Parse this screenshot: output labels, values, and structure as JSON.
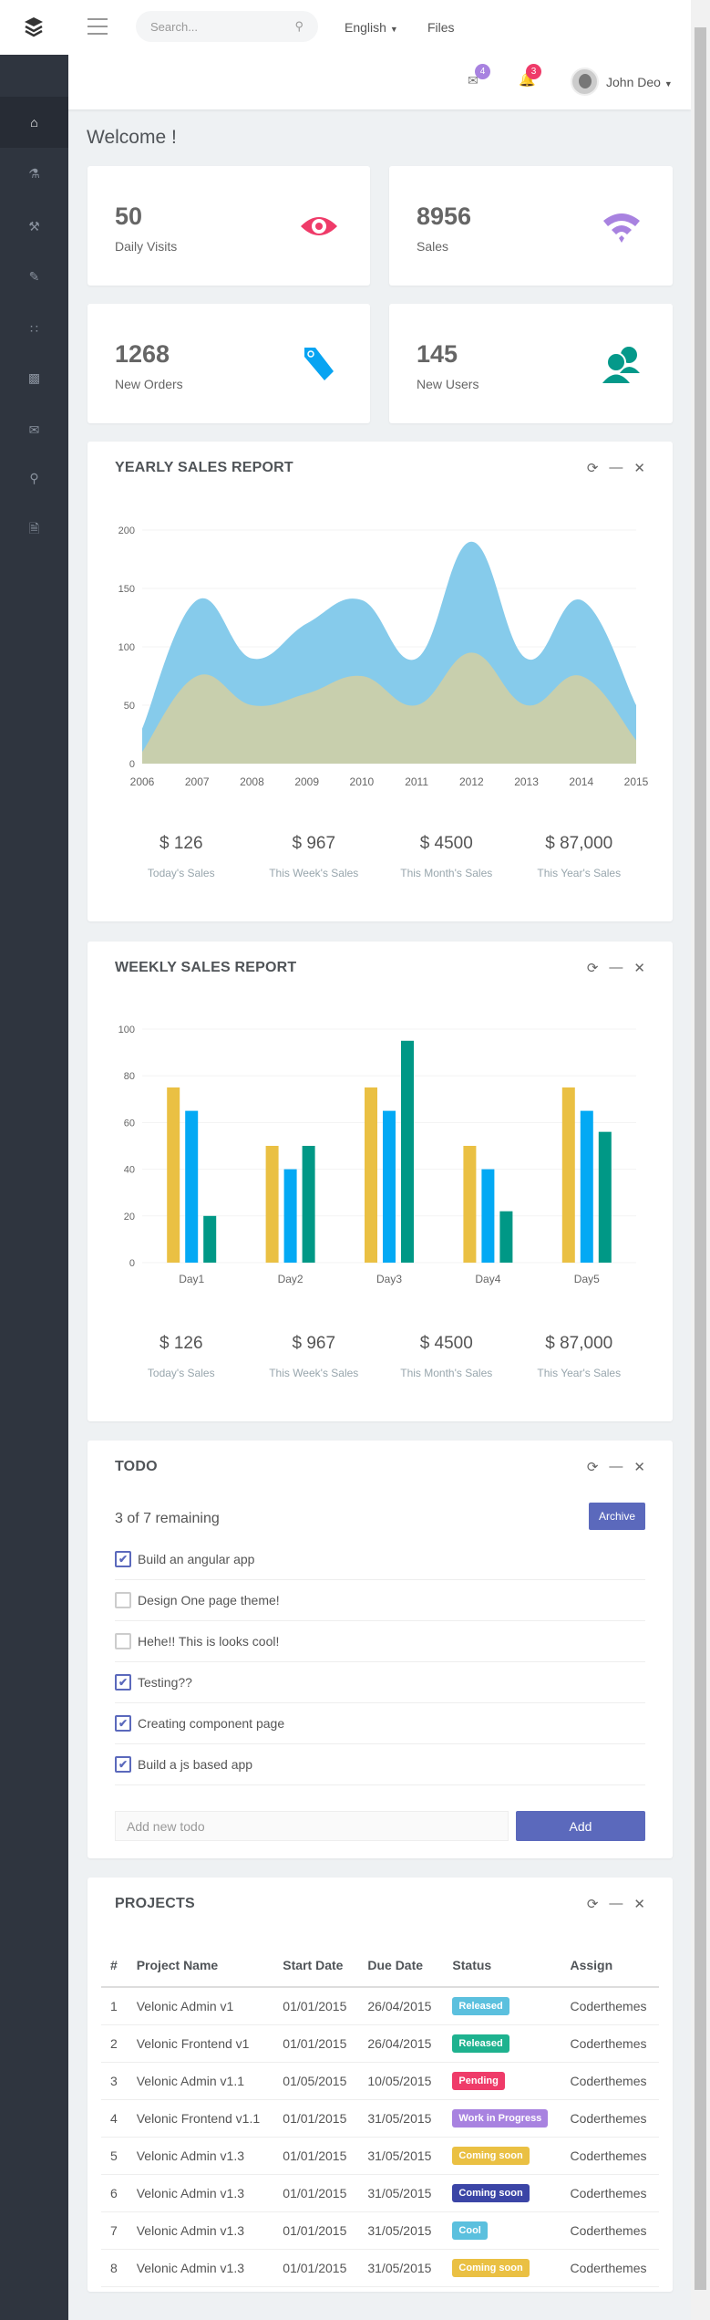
{
  "topbar": {
    "search_placeholder": "Search...",
    "language": "English",
    "files": "Files",
    "mail_count": "4",
    "notif_count": "3",
    "user_name": "John Deo"
  },
  "sidebar": {
    "items": [
      {
        "icon": "home-icon"
      },
      {
        "icon": "flask-icon"
      },
      {
        "icon": "tools-icon"
      },
      {
        "icon": "edit-icon"
      },
      {
        "icon": "grid-icon"
      },
      {
        "icon": "bar-chart-icon"
      },
      {
        "icon": "mail-icon"
      },
      {
        "icon": "map-pin-icon"
      },
      {
        "icon": "file-icon"
      }
    ]
  },
  "page_title": "Welcome !",
  "stats": [
    {
      "value": "50",
      "label": "Daily Visits",
      "icon": "eye-icon",
      "color": "#ef3b69"
    },
    {
      "value": "8956",
      "label": "Sales",
      "icon": "wifi-icon",
      "color": "#a882e0"
    },
    {
      "value": "1268",
      "label": "New Orders",
      "icon": "tag-icon",
      "color": "#08a4f2"
    },
    {
      "value": "145",
      "label": "New Users",
      "icon": "users-icon",
      "color": "#04998a"
    }
  ],
  "colors": {
    "accent": "#5b69bc",
    "yearly_a": "#86cbeb",
    "yearly_b": "#c8cfad",
    "bar1": "#eac043",
    "bar2": "#03a9f4",
    "bar3": "#009886"
  },
  "yearly": {
    "title": "YEARLY SALES REPORT",
    "summary": [
      {
        "value": "$ 126",
        "label": "Today's Sales"
      },
      {
        "value": "$ 967",
        "label": "This Week's Sales"
      },
      {
        "value": "$ 4500",
        "label": "This Month's Sales"
      },
      {
        "value": "$ 87,000",
        "label": "This Year's Sales"
      }
    ]
  },
  "weekly": {
    "title": "WEEKLY SALES REPORT",
    "summary": [
      {
        "value": "$ 126",
        "label": "Today's Sales"
      },
      {
        "value": "$ 967",
        "label": "This Week's Sales"
      },
      {
        "value": "$ 4500",
        "label": "This Month's Sales"
      },
      {
        "value": "$ 87,000",
        "label": "This Year's Sales"
      }
    ]
  },
  "chart_data": [
    {
      "type": "area",
      "x": [
        "2006",
        "2007",
        "2008",
        "2009",
        "2010",
        "2011",
        "2012",
        "2013",
        "2014",
        "2015"
      ],
      "ylim": [
        0,
        200
      ],
      "yticks": [
        0,
        50,
        100,
        150,
        200
      ],
      "grid": true,
      "series": [
        {
          "values": [
            30,
            140,
            90,
            120,
            140,
            90,
            190,
            90,
            140,
            50
          ]
        },
        {
          "values": [
            10,
            75,
            50,
            60,
            75,
            50,
            95,
            50,
            75,
            20
          ]
        }
      ]
    },
    {
      "type": "bar",
      "categories": [
        "Day1",
        "Day2",
        "Day3",
        "Day4",
        "Day5"
      ],
      "ylim": [
        0,
        100
      ],
      "yticks": [
        0,
        20,
        40,
        60,
        80,
        100
      ],
      "grid": true,
      "series": [
        {
          "values": [
            75,
            50,
            75,
            50,
            75
          ]
        },
        {
          "values": [
            65,
            40,
            65,
            40,
            65
          ]
        },
        {
          "values": [
            20,
            50,
            95,
            22,
            56
          ]
        }
      ]
    }
  ],
  "todo": {
    "title": "TODO",
    "remaining": "3 of 7 remaining",
    "archive": "Archive",
    "input_placeholder": "Add new todo",
    "add": "Add",
    "items": [
      {
        "text": "Build an angular app",
        "done": true
      },
      {
        "text": "Design One page theme!",
        "done": false
      },
      {
        "text": "Hehe!! This is looks cool!",
        "done": false
      },
      {
        "text": "Testing??",
        "done": true
      },
      {
        "text": "Creating component page",
        "done": true
      },
      {
        "text": "Build a js based app",
        "done": true
      }
    ]
  },
  "projects": {
    "title": "PROJECTS",
    "columns": [
      "#",
      "Project Name",
      "Start Date",
      "Due Date",
      "Status",
      "Assign"
    ],
    "rows": [
      [
        "1",
        "Velonic Admin v1",
        "01/01/2015",
        "26/04/2015",
        "Released",
        "Coderthemes",
        "#5bc0de"
      ],
      [
        "2",
        "Velonic Frontend v1",
        "01/01/2015",
        "26/04/2015",
        "Released",
        "Coderthemes",
        "#1eb28f"
      ],
      [
        "3",
        "Velonic Admin v1.1",
        "01/05/2015",
        "10/05/2015",
        "Pending",
        "Coderthemes",
        "#ef3b69"
      ],
      [
        "4",
        "Velonic Frontend v1.1",
        "01/01/2015",
        "31/05/2015",
        "Work in Progress",
        "Coderthemes",
        "#a882e0"
      ],
      [
        "5",
        "Velonic Admin v1.3",
        "01/01/2015",
        "31/05/2015",
        "Coming soon",
        "Coderthemes",
        "#eac043"
      ],
      [
        "6",
        "Velonic Admin v1.3",
        "01/01/2015",
        "31/05/2015",
        "Coming soon",
        "Coderthemes",
        "#3b45a6"
      ],
      [
        "7",
        "Velonic Admin v1.3",
        "01/01/2015",
        "31/05/2015",
        "Cool",
        "Coderthemes",
        "#5bc0de"
      ],
      [
        "8",
        "Velonic Admin v1.3",
        "01/01/2015",
        "31/05/2015",
        "Coming soon",
        "Coderthemes",
        "#eac043"
      ]
    ]
  }
}
